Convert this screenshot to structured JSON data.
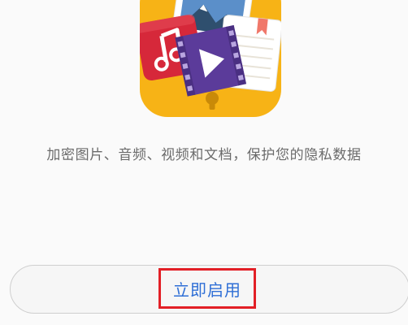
{
  "description": "加密图片、音频、视频和文档，保护您的隐私数据",
  "enable_button": {
    "label": "立即启用"
  },
  "icons": {
    "app": "safe-folder-icon",
    "photo": "photo-card-icon",
    "music": "music-card-icon",
    "video": "video-card-icon",
    "document": "document-card-icon",
    "keyhole": "keyhole-icon"
  },
  "colors": {
    "background": "#fafafa",
    "description_text": "#6b6b6b",
    "button_text": "#2f6fd6",
    "highlight_border": "#e21f26",
    "safe_body": "#f7b316",
    "music_card": "#d6283a",
    "video_card": "#5b3b9a"
  }
}
